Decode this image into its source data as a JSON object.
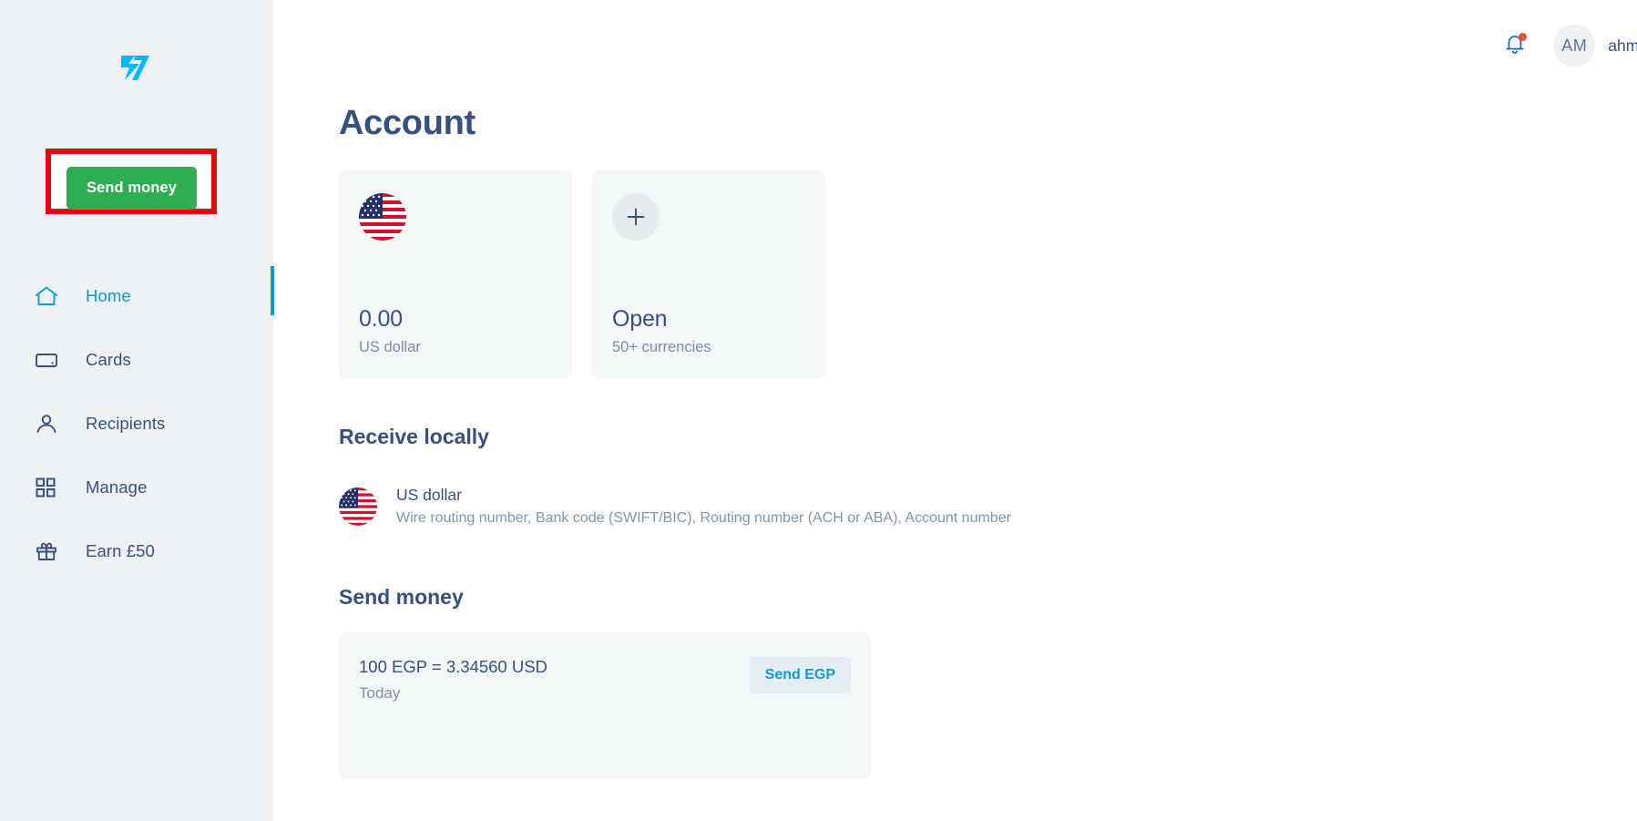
{
  "brand": {
    "logo_icon": "wise-logo-icon",
    "logo_color": "#00b9ff"
  },
  "sidebar": {
    "cta": {
      "label": "Send money",
      "icon": "send-money-button",
      "bg_color": "#2fad52",
      "highlight_color": "#e30613"
    },
    "items": [
      {
        "label": "Home",
        "icon": "home-icon",
        "active": true
      },
      {
        "label": "Cards",
        "icon": "card-icon",
        "active": false
      },
      {
        "label": "Recipients",
        "icon": "people-icon",
        "active": false
      },
      {
        "label": "Manage",
        "icon": "grid-icon",
        "active": false
      },
      {
        "label": "Earn £50",
        "icon": "gift-icon",
        "active": false
      }
    ],
    "active_indicator_color": "#0c9bd2"
  },
  "topbar": {
    "notifications": {
      "icon": "bell-icon",
      "has_unread": true,
      "dot_color": "#e8503a"
    },
    "user": {
      "initials": "AM",
      "name": "ahmed abbas mohamed",
      "chevron_icon": "chevron-down-icon"
    }
  },
  "main": {
    "page_title": "Account",
    "balance_cards": [
      {
        "icon": "us-flag-icon",
        "value": "0.00",
        "subtitle": "US dollar"
      },
      {
        "icon": "plus-icon",
        "value": "Open",
        "subtitle": "50+ currencies"
      }
    ],
    "receive_locally": {
      "title": "Receive locally",
      "row": {
        "icon": "us-flag-icon",
        "currency": "US dollar",
        "details": "Wire routing number, Bank code (SWIFT/BIC), Routing number (ACH or ABA), Account number",
        "chevron_icon": "chevron-right-icon"
      }
    },
    "send_money": {
      "title": "Send money",
      "rate": "100 EGP = 3.34560 USD",
      "date": "Today",
      "action_label": "Send EGP"
    }
  },
  "colors": {
    "navy": "#37517e",
    "muted": "#8094a8",
    "accent_blue": "#0f9ad4",
    "sidebar_bg": "#eff2f4",
    "card_bg": "#f4f7f8"
  }
}
